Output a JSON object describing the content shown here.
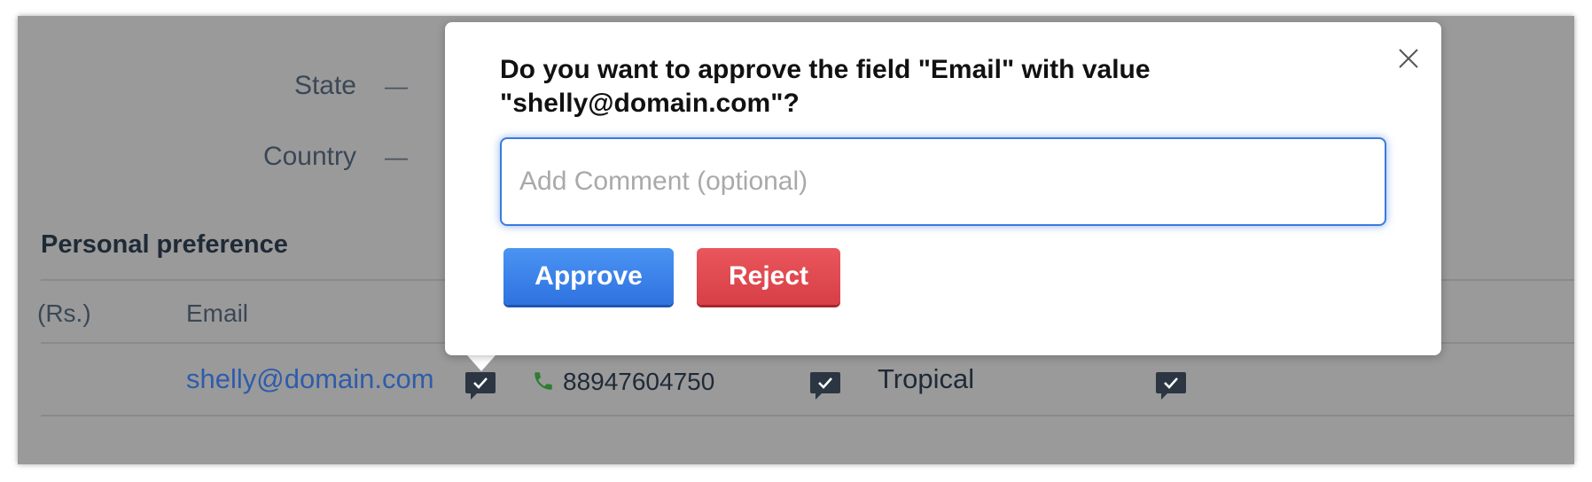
{
  "fields": [
    {
      "label": "State",
      "value": "—"
    },
    {
      "label": "Country",
      "value": "—"
    }
  ],
  "section": {
    "title": "Personal preference"
  },
  "table": {
    "headers": [
      "(Rs.)",
      "Email"
    ],
    "row": {
      "email": "shelly@domain.com",
      "phone": "88947604750",
      "preference": "Tropical"
    }
  },
  "popup": {
    "title": "Do you want to approve the field \"Email\" with value \"shelly@domain.com\"?",
    "comment_placeholder": "Add Comment (optional)",
    "comment_value": "",
    "approve_label": "Approve",
    "reject_label": "Reject",
    "close_icon": "close-icon"
  },
  "colors": {
    "overlay_bg": "#9a9a9a",
    "approve": "#2f72e0",
    "reject": "#d83f47",
    "link": "#2e5cab",
    "phone_icon": "#2e7d32"
  }
}
